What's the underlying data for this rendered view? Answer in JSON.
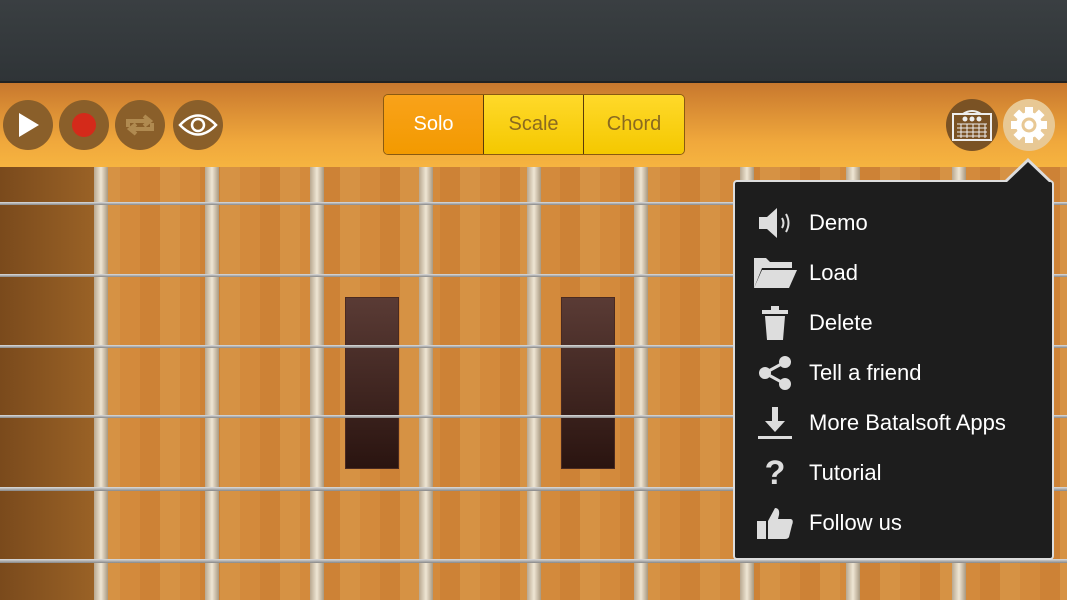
{
  "toolbar": {
    "play_icon": "play-icon",
    "record_icon": "record-icon",
    "loop_icon": "loop-icon",
    "view_icon": "eye-icon",
    "modes": [
      {
        "label": "Solo",
        "selected": true
      },
      {
        "label": "Scale",
        "selected": false
      },
      {
        "label": "Chord",
        "selected": false
      }
    ],
    "amp_icon": "amplifier-icon",
    "settings_icon": "gear-icon"
  },
  "menu": {
    "items": [
      {
        "label": "Demo",
        "icon": "speaker-icon"
      },
      {
        "label": "Load",
        "icon": "folder-icon"
      },
      {
        "label": "Delete",
        "icon": "trash-icon"
      },
      {
        "label": "Tell a friend",
        "icon": "share-icon"
      },
      {
        "label": "More Batalsoft Apps",
        "icon": "download-icon"
      },
      {
        "label": "Tutorial",
        "icon": "question-icon"
      },
      {
        "label": "Follow us",
        "icon": "thumbs-up-icon"
      }
    ]
  },
  "colors": {
    "selected_mode": "#f39a00",
    "unselected_mode": "#f4c800",
    "record": "#d42a1a",
    "menu_bg": "#1d1d1d"
  }
}
